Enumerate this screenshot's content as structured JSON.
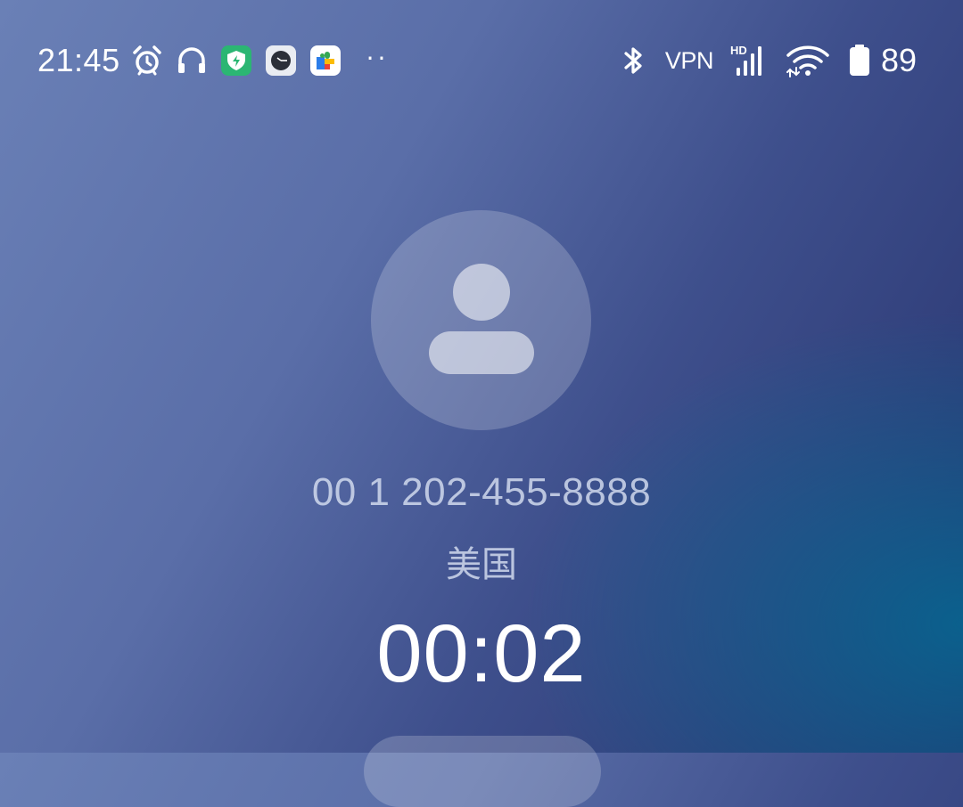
{
  "status_bar": {
    "time": "21:45",
    "left_icons": [
      "alarm-icon",
      "headphones-icon",
      "security-app-icon",
      "clock-app-icon",
      "play-services-icon"
    ],
    "overflow_dots": "··",
    "right_icons": [
      "bluetooth-icon",
      "vpn-indicator",
      "hd-signal-icon",
      "wifi-icon",
      "battery-icon"
    ],
    "vpn_label": "VPN",
    "battery_level": "89"
  },
  "call": {
    "phone_number": "00 1 202-455-8888",
    "location": "美国",
    "duration": "00:02"
  },
  "colors": {
    "background_top_left": "#6a80b6",
    "background_bottom_right": "#006e96",
    "security_badge": "#2bb673"
  }
}
